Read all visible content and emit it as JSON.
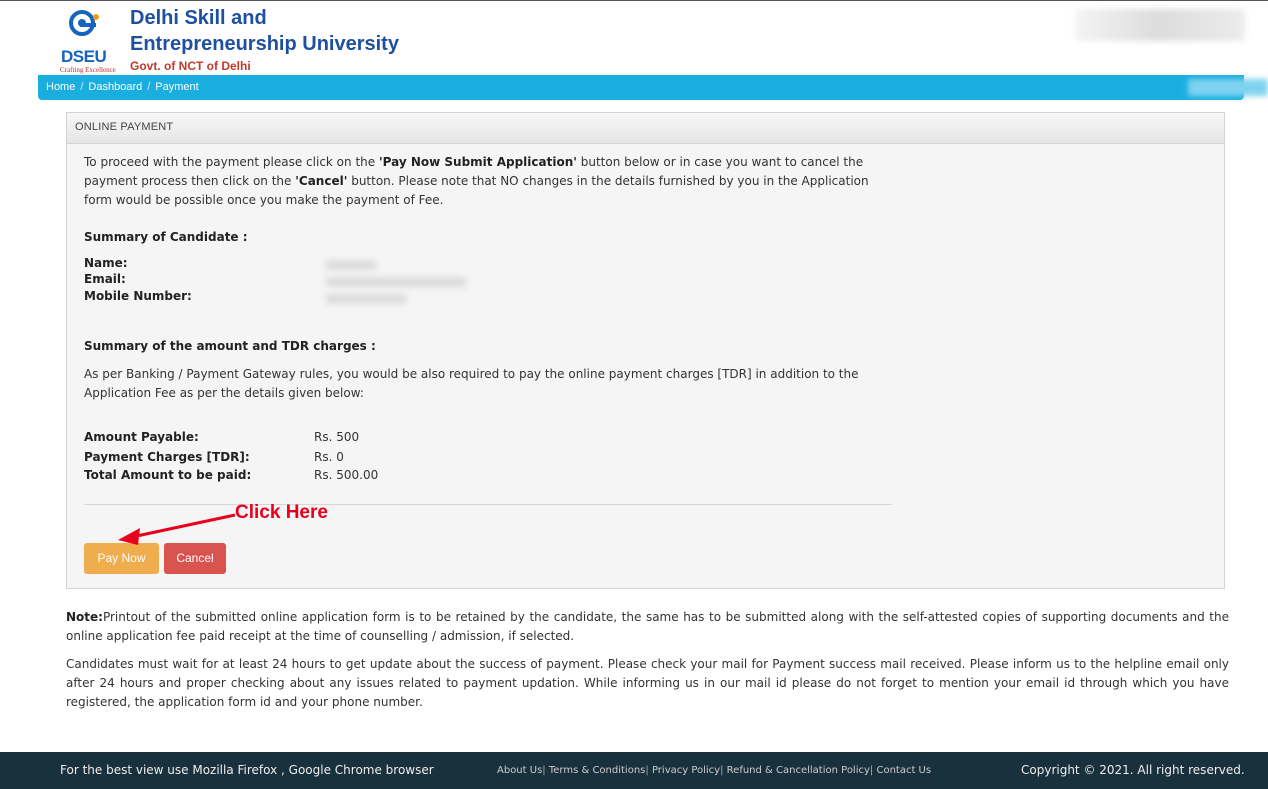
{
  "header": {
    "university_line1": "Delhi Skill and",
    "university_line2": "Entrepreneurship University",
    "govt": "Govt. of NCT of Delhi",
    "logo_abbr": "DSEU",
    "logo_tagline": "Crafting Excellence",
    "brand_color": "#1f4fa0",
    "bar_color": "#1aaee0"
  },
  "breadcrumb": {
    "items": [
      "Home",
      "Dashboard",
      "Payment"
    ],
    "separator": "/"
  },
  "panel": {
    "title": "ONLINE PAYMENT",
    "intro_part1": "To proceed with the payment please click on the ",
    "intro_bold1": "'Pay Now Submit Application'",
    "intro_part2": " button below or in case you want to cancel the payment process then click on the ",
    "intro_bold2": "'Cancel'",
    "intro_part3": " button. Please note that NO changes in the details furnished by you in the Application form would be possible once you make the payment of Fee.",
    "candidate_title": "Summary of Candidate :",
    "name_label": "Name:",
    "email_label": "Email:",
    "mobile_label": "Mobile Number:",
    "amount_title": "Summary of the amount and TDR charges :",
    "amount_para": "As per Banking / Payment Gateway rules, you would be also required to pay the online payment charges [TDR] in addition to the Application Fee as per the details given below:",
    "amount_payable_label": "Amount Payable:",
    "amount_payable_value": "Rs. 500",
    "tdr_label": "Payment Charges [TDR]:",
    "tdr_value": "Rs. 0",
    "total_label": "Total Amount to be paid:",
    "total_value": "Rs. 500.00",
    "pay_button": "Pay Now",
    "cancel_button": "Cancel",
    "pay_color": "#f0ad4e",
    "cancel_color": "#d9534f"
  },
  "annotation": {
    "text": "Click Here",
    "color": "#e8001c"
  },
  "notes": {
    "note_label": "Note:",
    "note_text": "Printout of the submitted online application form is to be retained by the candidate, the same has to be submitted along with the self-attested copies of supporting documents and the online application fee paid receipt at the time of counselling / admission, if selected.",
    "wait_text": "Candidates must wait for at least 24 hours to get update about the success of payment. Please check your mail for Payment success mail received. Please inform us to the helpline email only after 24 hours and proper checking about any issues related to payment updation. While informing us in our mail id please do not forget to mention your email id through which you have registered, the application form id and your phone number."
  },
  "footer": {
    "browser_note": "For the best view use Mozilla Firefox , Google Chrome browser",
    "links": [
      "About Us",
      "Terms & Conditions",
      "Privacy Policy",
      "Refund & Cancellation Policy",
      "Contact Us"
    ],
    "copyright": "Copyright © 2021. All right reserved.",
    "bg_color": "#19313d"
  }
}
